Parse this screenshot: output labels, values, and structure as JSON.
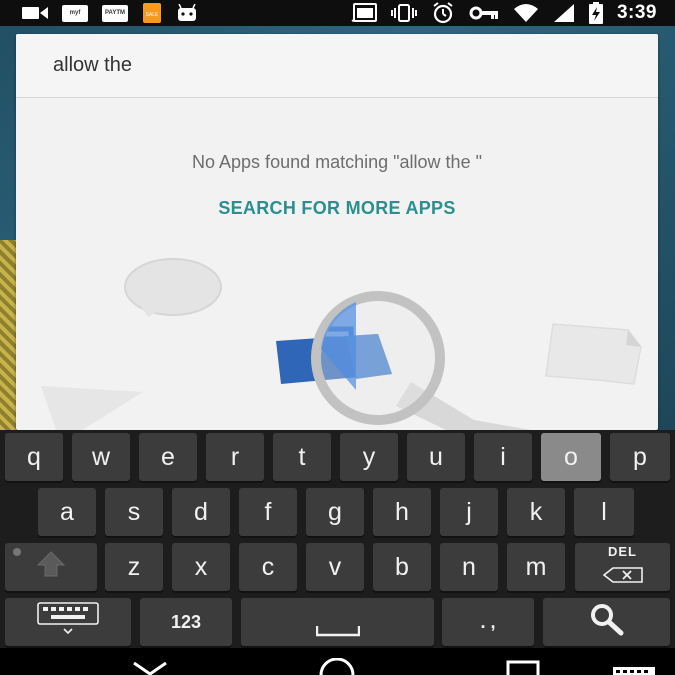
{
  "status_bar": {
    "time": "3:39",
    "left_icons": [
      "video-icon",
      "notification-badge-icon",
      "notification-badge-icon",
      "sim-app-icon",
      "android-icon"
    ],
    "left_badges": [
      "myf",
      "PAYTM",
      "SALE"
    ],
    "right_icons": [
      "cast-icon",
      "vibrate-icon",
      "alarm-icon",
      "vpn-key-icon",
      "wifi-icon",
      "cell-signal-icon",
      "battery-charging-icon"
    ]
  },
  "search": {
    "query": "allow the",
    "no_results": "No Apps found matching \"allow the \"",
    "search_more_label": "SEARCH FOR MORE APPS"
  },
  "keyboard": {
    "row1": [
      "q",
      "w",
      "e",
      "r",
      "t",
      "y",
      "u",
      "i",
      "o",
      "p"
    ],
    "row2": [
      "a",
      "s",
      "d",
      "f",
      "g",
      "h",
      "j",
      "k",
      "l"
    ],
    "row3": [
      "z",
      "x",
      "c",
      "v",
      "b",
      "n",
      "m"
    ],
    "pressed_key": "o",
    "shift_icon": "shift-arrow-icon",
    "delete_label": "DEL",
    "symbols_label": "123",
    "space_icon": "space-bar-icon",
    "punct_label": ". ,",
    "keyboard_switch_icon": "keyboard-icon",
    "search_icon": "search-icon"
  },
  "nav_bar": {
    "icons": [
      "back-icon",
      "home-icon",
      "recents-icon",
      "keyboard-icon"
    ]
  },
  "colors": {
    "accent": "#2a8f8f",
    "card_bg": "#f2f2f2",
    "key_bg": "#3c3c3c",
    "key_pressed": "#8a8a8a"
  }
}
